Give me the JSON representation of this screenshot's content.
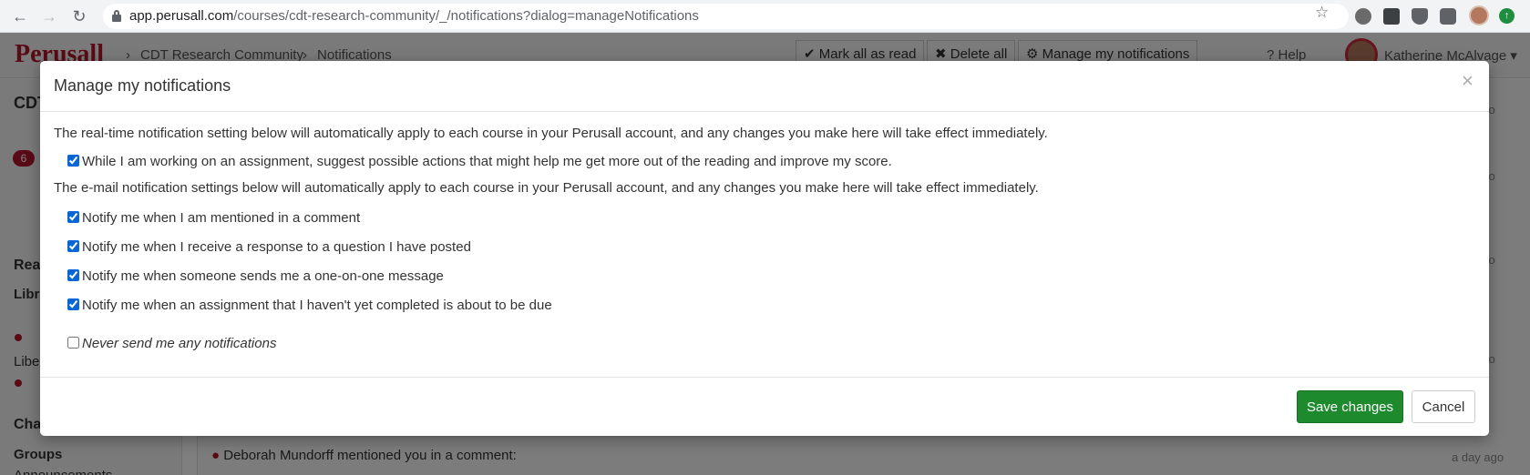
{
  "browser": {
    "url_host": "app.perusall.com",
    "url_path": "/courses/cdt-research-community/_/notifications?dialog=manageNotifications",
    "icons": [
      "back-arrow-icon",
      "forward-arrow-icon",
      "reload-icon",
      "lock-icon",
      "star-icon",
      "extension-icon",
      "profile-icon",
      "update-icon"
    ]
  },
  "app": {
    "logo": "Perusall",
    "breadcrumb": [
      "CDT Research Community",
      "Notifications"
    ],
    "header_buttons": {
      "mark_all_read": "Mark all as read",
      "delete_all": "Delete all",
      "manage": "Manage my notifications"
    },
    "help": "Help",
    "user_name": "Katherine McAlvage",
    "sidebar": {
      "course_abbrev": "CDT",
      "badge_count": "6",
      "reading_heading": "Rea",
      "library_heading": "Libr",
      "library_item": "Libe",
      "chat_heading": "Cha",
      "groups_label": "Groups",
      "announcements": "Announcements"
    },
    "feed": {
      "item_text": "Deborah Mundorff mentioned you in a comment:",
      "item_time": "a day ago",
      "side_times": [
        "ago",
        "ago",
        "ago",
        "ago"
      ]
    }
  },
  "modal": {
    "title": "Manage my notifications",
    "close": "×",
    "realtime_intro": "The real-time notification setting below will automatically apply to each course in your Perusall account, and any changes you make here will take effect immediately.",
    "realtime_option": {
      "label": "While I am working on an assignment, suggest possible actions that might help me get more out of the reading and improve my score.",
      "checked": true
    },
    "email_intro": "The e-mail notification settings below will automatically apply to each course in your Perusall account, and any changes you make here will take effect immediately.",
    "email_options": [
      {
        "label": "Notify me when I am mentioned in a comment",
        "checked": true
      },
      {
        "label": "Notify me when I receive a response to a question I have posted",
        "checked": true
      },
      {
        "label": "Notify me when someone sends me a one-on-one message",
        "checked": true
      },
      {
        "label": "Notify me when an assignment that I haven't yet completed is about to be due",
        "checked": true
      }
    ],
    "never_option": {
      "label": "Never send me any notifications",
      "checked": false
    },
    "save_label": "Save changes",
    "cancel_label": "Cancel"
  },
  "colors": {
    "brand_red": "#b3162b",
    "save_green": "#1e8a2e"
  }
}
